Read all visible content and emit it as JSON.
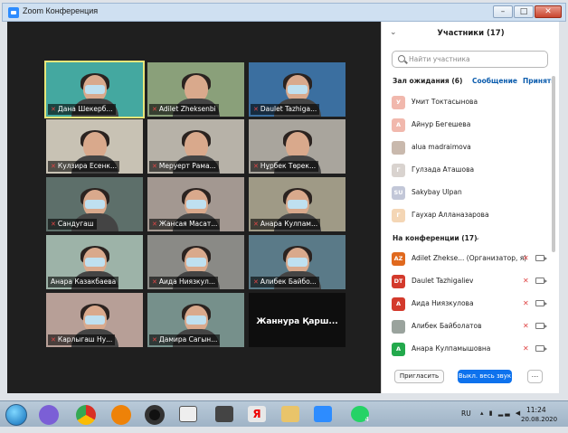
{
  "window": {
    "title": "Zoom Конференция",
    "min": "–",
    "max": "□",
    "close": "✕"
  },
  "tiles": [
    {
      "name": "Дана Шекерб...",
      "mic": true,
      "bg": "#44a8a0",
      "mask": true,
      "active": true
    },
    {
      "name": "Adilet Zheksenbi",
      "mic": true,
      "bg": "#8aa07a",
      "mask": false,
      "active": false
    },
    {
      "name": "Daulet Tazhiga...",
      "mic": true,
      "bg": "#3b6fa0",
      "mask": true,
      "active": false
    },
    {
      "name": "Кулзира Есенк...",
      "mic": true,
      "bg": "#c8c2b4",
      "mask": false,
      "active": false
    },
    {
      "name": "Меруерт Рама...",
      "mic": true,
      "bg": "#b7b2a8",
      "mask": false,
      "active": false
    },
    {
      "name": "Нұрбек Төрек...",
      "mic": true,
      "bg": "#a9a59d",
      "mask": false,
      "active": false
    },
    {
      "name": "Сандугаш",
      "mic": true,
      "bg": "#5d6f6a",
      "mask": true,
      "active": false
    },
    {
      "name": "Жансая Масат...",
      "mic": true,
      "bg": "#a39891",
      "mask": true,
      "active": false
    },
    {
      "name": "Анара Кулпам...",
      "mic": true,
      "bg": "#9f9a86",
      "mask": true,
      "active": false
    },
    {
      "name": "Анара Казакбаева",
      "mic": false,
      "bg": "#9db3a8",
      "mask": true,
      "active": false
    },
    {
      "name": "Аида Ниязкул...",
      "mic": true,
      "bg": "#8a8a86",
      "mask": true,
      "active": false
    },
    {
      "name": "Алибек Байбо...",
      "mic": true,
      "bg": "#5a7a88",
      "mask": true,
      "active": false
    },
    {
      "name": "Карлыгаш Ну...",
      "mic": true,
      "bg": "#b79f97",
      "mask": true,
      "active": false
    },
    {
      "name": "Дамира Сагын...",
      "mic": true,
      "bg": "#76908b",
      "mask": true,
      "active": false
    },
    {
      "name": "Жаннура Қарш...",
      "mic": false,
      "bg": "#0e0e0e",
      "mask": false,
      "active": false,
      "name_only": true
    }
  ],
  "panel": {
    "title": "Участники (17)",
    "search_placeholder": "Найти участника",
    "waiting_header": "Зал ожидания (6)",
    "message_link": "Сообщение",
    "admit_link": "Принять",
    "waiting": [
      {
        "initial": "У",
        "name": "Умит Токтасынова",
        "color": "#f1b8ad"
      },
      {
        "initial": "А",
        "name": "Айнур Бегешева",
        "color": "#f1b8ad"
      },
      {
        "initial": "",
        "name": "alua madraimova",
        "color": "#c9b9ad"
      },
      {
        "initial": "Г",
        "name": "Гулзада Аташова",
        "color": "#d9d3cf"
      },
      {
        "initial": "SU",
        "name": "Sakybay Ulpan",
        "color": "#c2c7d8"
      },
      {
        "initial": "Г",
        "name": "Гаухар Алланазарова",
        "color": "#f4d6b5"
      }
    ],
    "conf_header": "На конференции (17)",
    "in_meeting": [
      {
        "initial": "AZ",
        "name": "Adilet Zhekse... (Организатор, я)",
        "color": "#e0691e"
      },
      {
        "initial": "DT",
        "name": "Daulet Tazhigaliev",
        "color": "#d33a2c"
      },
      {
        "initial": "А",
        "name": "Аида Ниязкулова",
        "color": "#d33a2c"
      },
      {
        "initial": "",
        "name": "Алибек Байболатов",
        "color": "#9aa39d"
      },
      {
        "initial": "А",
        "name": "Анара Кулпамышовна",
        "color": "#23a94c"
      }
    ],
    "invite_label": "Пригласить",
    "mute_all_label": "Выкл. весь звук",
    "more_label": "..."
  },
  "taskbar": {
    "lang": "RU",
    "time": "11:24",
    "date": "20.08.2020",
    "badge": "4"
  }
}
